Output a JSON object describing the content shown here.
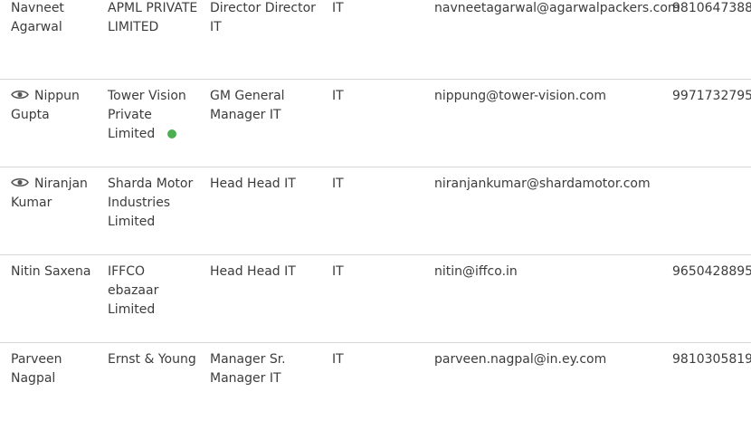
{
  "colors": {
    "online": "#4caf50",
    "icon": "#555555",
    "divider": "#d6d6d6"
  },
  "rows": [
    {
      "name": "Navneet Agarwal",
      "company": "APML PRIVATE LIMITED",
      "title": "Director Director IT",
      "department": "IT",
      "email": "navneetagarwal@agarwalpackers.com",
      "phone": "9810647388",
      "icon": null,
      "online": false
    },
    {
      "name": "Nippun Gupta",
      "company": "Tower Vision Private Limited",
      "title": "GM General Manager IT",
      "department": "IT",
      "email": "nippung@tower-vision.com",
      "phone": "9971732795",
      "icon": "eye-icon",
      "online": true
    },
    {
      "name": "Niranjan Kumar",
      "company": "Sharda Motor Industries Limited",
      "title": "Head Head IT",
      "department": "IT",
      "email": "niranjankumar@shardamotor.com",
      "phone": "",
      "icon": "eye-icon",
      "online": false
    },
    {
      "name": "Nitin Saxena",
      "company": "IFFCO ebazaar Limited",
      "title": "Head Head IT",
      "department": "IT",
      "email": "nitin@iffco.in",
      "phone": "9650428895",
      "icon": null,
      "online": false
    },
    {
      "name": "Parveen Nagpal",
      "company": "Ernst & Young",
      "title": "Manager Sr. Manager IT",
      "department": "IT",
      "email": "parveen.nagpal@in.ey.com",
      "phone": "9810305819",
      "icon": null,
      "online": false
    }
  ]
}
